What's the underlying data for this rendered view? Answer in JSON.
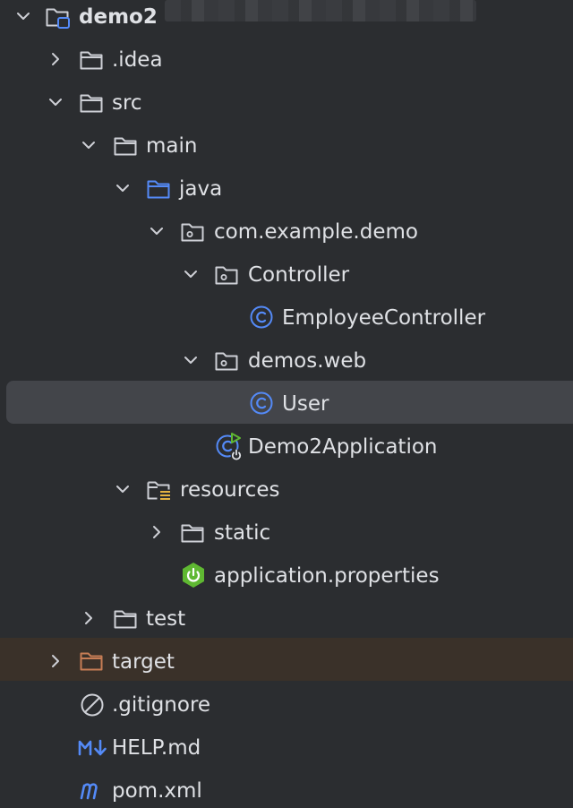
{
  "project": {
    "name": "demo2",
    "path_redacted": true
  },
  "tree": {
    "idea": ".idea",
    "src": "src",
    "main": "main",
    "java": "java",
    "package": "com.example.demo",
    "controller_pkg": "Controller",
    "employee_controller": "EmployeeController",
    "demos_web": "demos.web",
    "user": "User",
    "app_class": "Demo2Application",
    "resources": "resources",
    "static": "static",
    "app_properties": "application.properties",
    "test": "test",
    "target": "target",
    "gitignore": ".gitignore",
    "help": "HELP.md",
    "pom": "pom.xml"
  },
  "icons": {
    "folder": "folder-icon",
    "source_folder": "source-folder-icon",
    "package": "package-icon",
    "class": "class-icon",
    "spring_app": "spring-boot-app-icon",
    "resources_folder": "resources-folder-icon",
    "spring_properties": "spring-properties-icon",
    "excluded_folder": "excluded-folder-icon",
    "gitignore": "ignore-file-icon",
    "markdown": "markdown-icon",
    "maven": "maven-icon"
  },
  "colors": {
    "background": "#2b2d30",
    "selection": "#43454a",
    "excluded_row": "#3a3129",
    "text": "#dfe1e5",
    "icon_gray": "#ced0d6",
    "icon_blue": "#548af7",
    "excluded_orange": "#c77d55",
    "spring_green": "#5fb832"
  }
}
